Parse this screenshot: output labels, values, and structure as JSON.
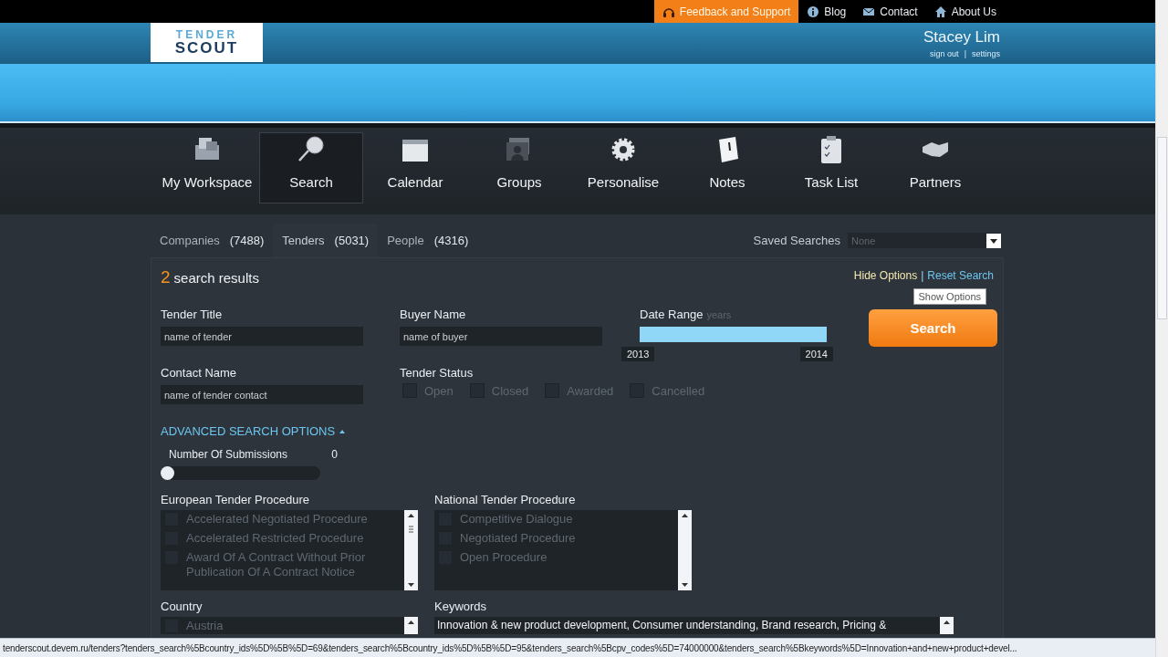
{
  "top_bar": {
    "links": [
      {
        "label": "Feedback and Support",
        "kind": "feedback"
      },
      {
        "label": "Blog",
        "kind": "info"
      },
      {
        "label": "Contact",
        "kind": "mail"
      },
      {
        "label": "About Us",
        "kind": "home"
      }
    ]
  },
  "header": {
    "logo": {
      "line_1": "TENDER",
      "line_2": "SCOUT"
    },
    "user": {
      "name": "Stacey Lim",
      "links": [
        "sign out",
        "settings"
      ],
      "separator": "|"
    }
  },
  "nav": [
    {
      "label": "My Workspace",
      "selected": false
    },
    {
      "label": "Search",
      "selected": true
    },
    {
      "label": "Calendar",
      "selected": false
    },
    {
      "label": "Groups",
      "selected": false
    },
    {
      "label": "Personalise",
      "selected": false
    },
    {
      "label": "Notes",
      "selected": false
    },
    {
      "label": "Task List",
      "selected": false
    },
    {
      "label": "Partners",
      "selected": false
    }
  ],
  "tabs": [
    {
      "label": "Companies",
      "count": "(7488)",
      "selected": false
    },
    {
      "label": "Tenders",
      "count": "(5031)",
      "selected": true
    },
    {
      "label": "People",
      "count": "(4316)",
      "selected": false
    }
  ],
  "saved_searches": {
    "label": "Saved Searches",
    "value": "None"
  },
  "results": {
    "count": "2",
    "label": "search results"
  },
  "option_links": [
    {
      "label": "Hide Options",
      "hovered": true
    },
    {
      "label": "Reset Search",
      "hovered": false
    }
  ],
  "option_separator": "|",
  "tooltip": "Show Options",
  "tender_title": {
    "label": "Tender Title",
    "placeholder": "name of tender"
  },
  "buyer_name": {
    "label": "Buyer Name",
    "placeholder": "name of buyer"
  },
  "contact_name": {
    "label": "Contact Name",
    "placeholder": "name of tender contact"
  },
  "date_range": {
    "label": "Date Range",
    "unit": "years",
    "level": 1,
    "start": "2013",
    "end": "2014"
  },
  "search_button": "Search",
  "tender_status": {
    "label": "Tender Status",
    "options": [
      {
        "label": "Open",
        "checked": false
      },
      {
        "label": "Closed",
        "checked": false
      },
      {
        "label": "Awarded",
        "checked": false
      },
      {
        "label": "Cancelled",
        "checked": false
      }
    ]
  },
  "advanced": {
    "label": "ADVANCED SEARCH OPTIONS",
    "expanded": true
  },
  "submissions": {
    "label": "Number Of Submissions",
    "value": "0",
    "level": 0
  },
  "european_procedure": {
    "label": "European Tender Procedure",
    "options": [
      {
        "label": "Accelerated Negotiated Procedure",
        "checked": false
      },
      {
        "label": "Accelerated Restricted Procedure",
        "checked": false
      },
      {
        "label": "Award Of A Contract Without Prior Publication Of A Contract Notice",
        "checked": false
      }
    ]
  },
  "national_procedure": {
    "label": "National Tender Procedure",
    "options": [
      {
        "label": "Competitive Dialogue",
        "checked": false
      },
      {
        "label": "Negotiated Procedure",
        "checked": false
      },
      {
        "label": "Open Procedure",
        "checked": false
      }
    ]
  },
  "country": {
    "label": "Country",
    "options": [
      {
        "label": "Austria",
        "checked": false
      }
    ]
  },
  "keywords": {
    "label": "Keywords",
    "value": "Innovation & new product development, Consumer understanding, Brand research, Pricing &"
  },
  "status_bar": "tenderscout.devem.ru/tenders?tenders_search%5Bcountry_ids%5D%5B%5D=69&tenders_search%5Bcountry_ids%5D%5B%5D=95&tenders_search%5Bcpv_codes%5D=74000000&tenders_search%5Bkeywords%5D=Innovation+and+new+product+devel..."
}
